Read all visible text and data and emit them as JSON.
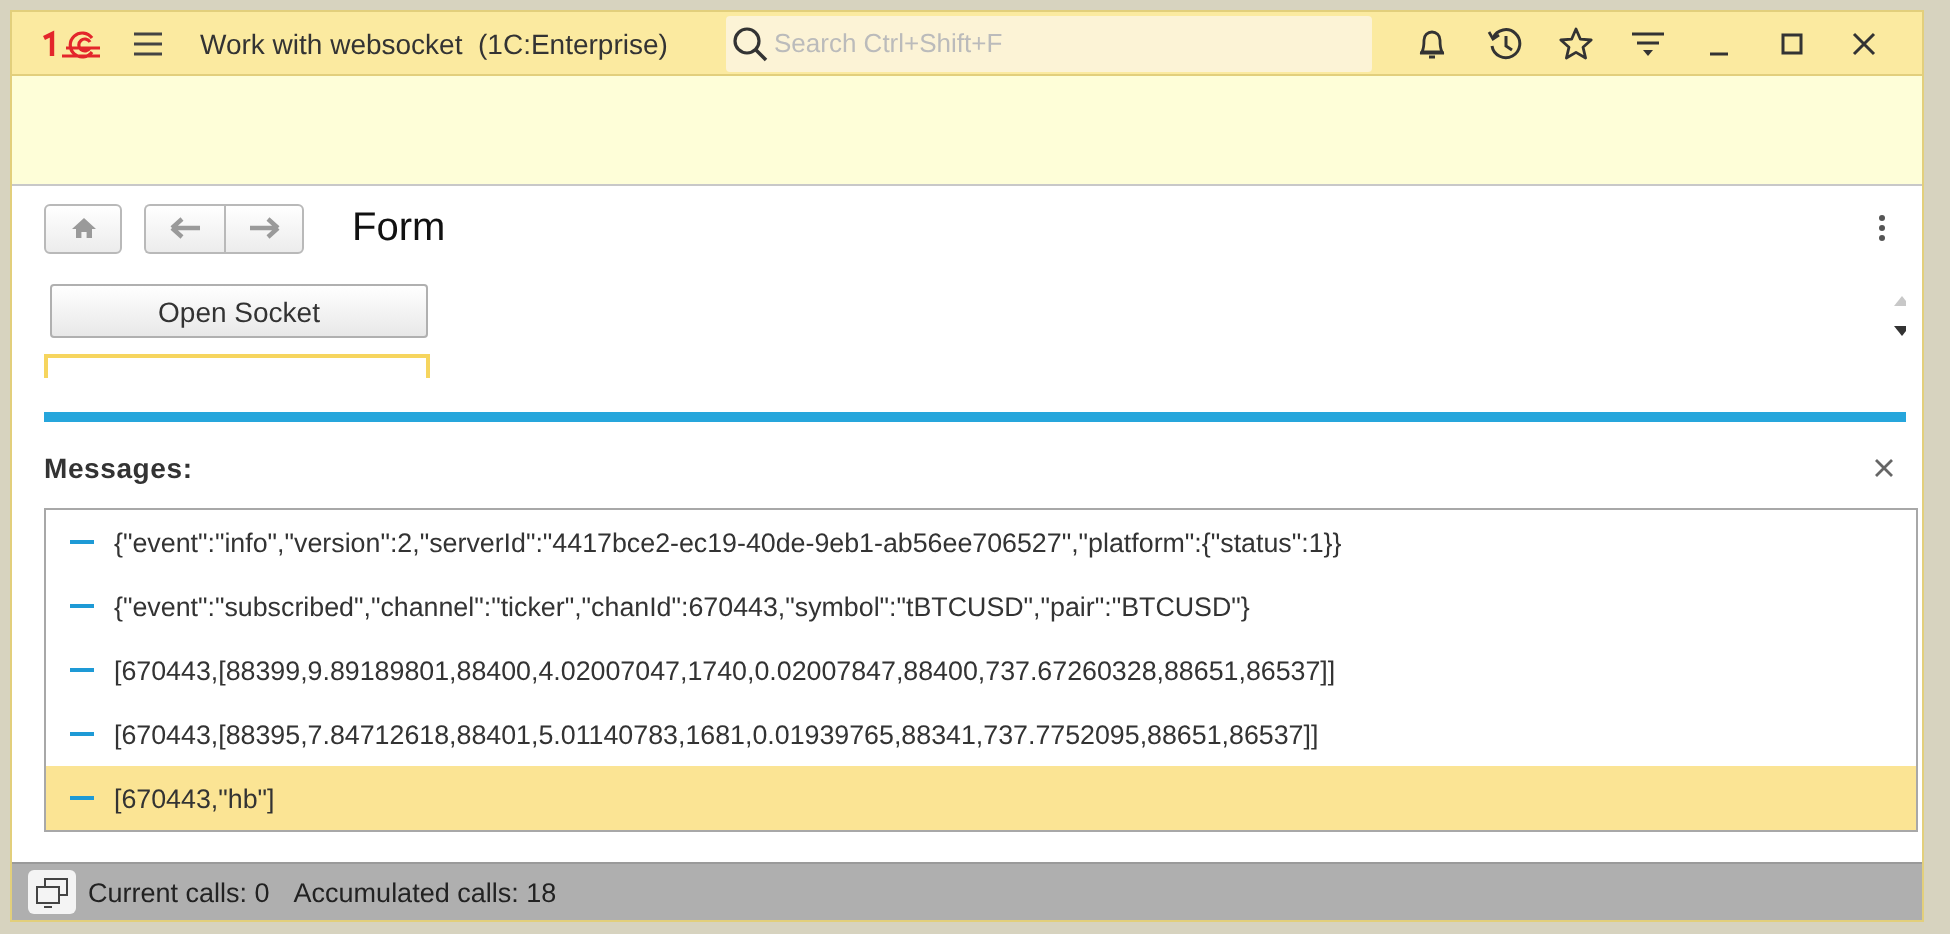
{
  "window": {
    "title": "Work with websocket  (1C:Enterprise)"
  },
  "search": {
    "placeholder": "Search Ctrl+Shift+F"
  },
  "form": {
    "title": "Form",
    "open_button": "Open Socket"
  },
  "messages": {
    "title": "Messages:",
    "rows": [
      {
        "text": "{\"event\":\"info\",\"version\":2,\"serverId\":\"4417bce2-ec19-40de-9eb1-ab56ee706527\",\"platform\":{\"status\":1}}",
        "selected": false
      },
      {
        "text": "{\"event\":\"subscribed\",\"channel\":\"ticker\",\"chanId\":670443,\"symbol\":\"tBTCUSD\",\"pair\":\"BTCUSD\"}",
        "selected": false
      },
      {
        "text": "[670443,[88399,9.89189801,88400,4.02007047,1740,0.02007847,88400,737.67260328,88651,86537]]",
        "selected": false
      },
      {
        "text": "[670443,[88395,7.84712618,88401,5.01140783,1681,0.01939765,88341,737.7752095,88651,86537]]",
        "selected": false
      },
      {
        "text": "[670443,\"hb\"]",
        "selected": true
      }
    ]
  },
  "status_bar": {
    "current_calls": "Current calls: 0",
    "accumulated_calls": "Accumulated calls: 18"
  }
}
